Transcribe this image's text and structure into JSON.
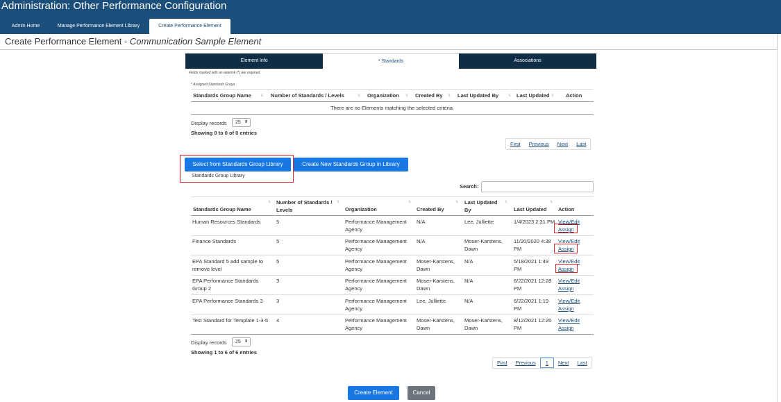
{
  "header": {
    "title": "Administration: Other Performance Configuration",
    "nav": [
      "Admin Home",
      "Manage Performance Element Library",
      "Create Performance Element"
    ]
  },
  "page": {
    "title_prefix": "Create Performance Element - ",
    "title_element": "Communication Sample Element"
  },
  "wizard_tabs": [
    "Element Info",
    "* Standards",
    "Associations"
  ],
  "required_note": "Fields marked with an asterisk (*) are required.",
  "assigned_label": "* Assigned Standards Group",
  "assigned_table": {
    "headers": [
      "Standards Group Name",
      "Number of Standards / Levels",
      "Organization",
      "Created By",
      "Last Updated By",
      "Last Updated",
      "Action"
    ],
    "empty_message": "There are no Elements matching the selected criteria.",
    "display_label": "Display records",
    "display_value": "25",
    "showing": "Showing 0 to 0 of 0 entries",
    "pager": [
      "First",
      "Previous",
      "Next",
      "Last"
    ]
  },
  "buttons": {
    "select_library": "Select from Standards Group Library",
    "create_new": "Create New Standards Group in Library",
    "create_element": "Create Element",
    "cancel": "Cancel"
  },
  "library_link": "Standards Group Library",
  "search_label": "Search:",
  "library_table": {
    "headers": [
      "Standards Group Name",
      "Number of Standards / Levels",
      "Organization",
      "Created By",
      "Last Updated By",
      "Last Updated",
      "Action"
    ],
    "rows": [
      {
        "name": "Human Resources Standards",
        "num": "5",
        "org": "Performance Management Agency",
        "created": "N/A",
        "updated_by": "Lee, Julliette",
        "updated": "1/4/2023 2:31 PM"
      },
      {
        "name": "Finance Standards",
        "num": "5",
        "org": "Performance Management Agency",
        "created": "N/A",
        "updated_by": "Moser-Karstens, Dawn",
        "updated": "11/20/2020 4:38 PM"
      },
      {
        "name": "EPA Standard 5 add sample to remove level",
        "num": "5",
        "org": "Performance Management Agency",
        "created": "Moser-Karstens, Dawn",
        "updated_by": "N/A",
        "updated": "5/18/2021 1:49 PM"
      },
      {
        "name": "EPA Performance Standards Group 2",
        "num": "3",
        "org": "Performance Management Agency",
        "created": "Moser-Karstens, Dawn",
        "updated_by": "N/A",
        "updated": "6/22/2021 12:28 PM"
      },
      {
        "name": "EPA Performance Standards 3",
        "num": "3",
        "org": "Performance Management Agency",
        "created": "Lee, Julliette",
        "updated_by": "N/A",
        "updated": "6/22/2021 1:19 PM"
      },
      {
        "name": "Test Standard for Template 1-3-5",
        "num": "4",
        "org": "Performance Management Agency",
        "created": "Moser-Karstens, Dawn",
        "updated_by": "Moser-Karstens, Dawn",
        "updated": "8/12/2021 12:26 PM"
      }
    ],
    "action_view": "View/Edit",
    "action_assign": "Assign",
    "display_label": "Display records",
    "display_value": "25",
    "showing": "Showing 1 to 6 of 6 entries",
    "pager": [
      "First",
      "Previous",
      "1",
      "Next",
      "Last"
    ]
  },
  "colors": {
    "header": "#1b4e7a",
    "dark_tab": "#0f2d47",
    "primary": "#1677e5",
    "secondary": "#6c757d",
    "highlight": "#e0252b"
  }
}
